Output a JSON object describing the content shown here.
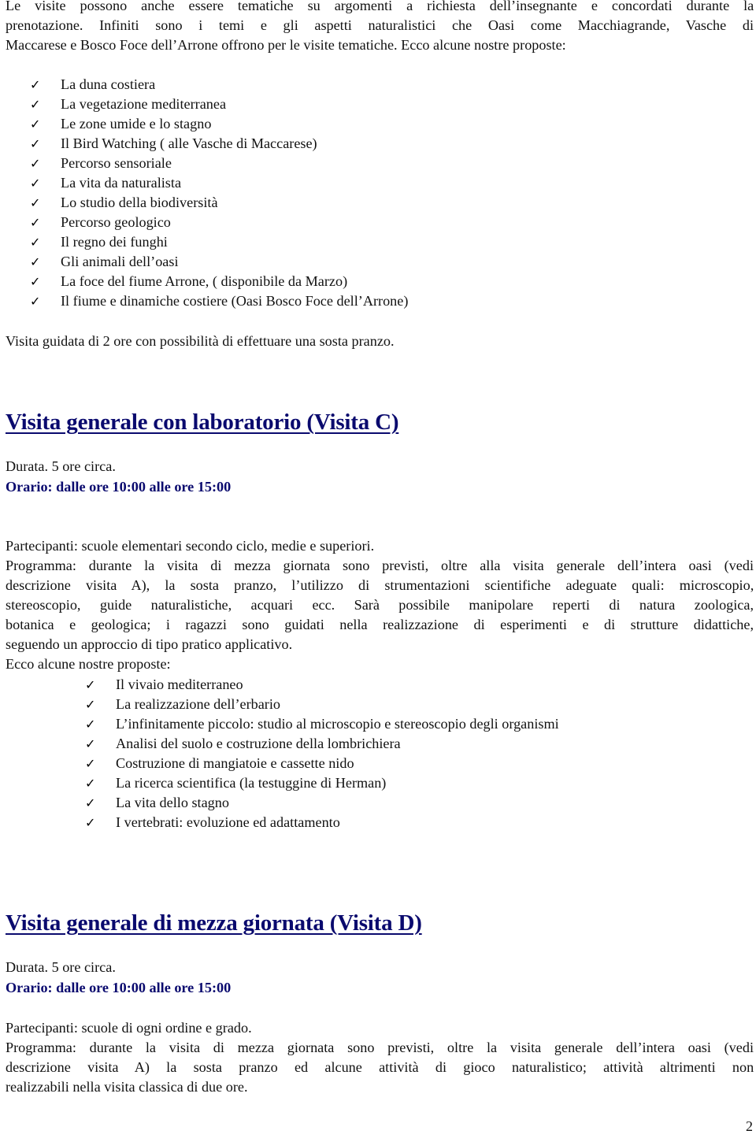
{
  "intro": {
    "lines": [
      "Le visite possono anche essere tematiche su argomenti a richiesta dell’insegnante e concordati durante la",
      "prenotazione. Infiniti sono i temi e gli aspetti naturalistici che Oasi come Macchiagrande, Vasche di",
      "Maccarese e Bosco Foce dell’Arrone offrono per le visite tematiche. Ecco alcune nostre proposte:"
    ]
  },
  "thematic_list": {
    "icon": "checkmark-icon",
    "glyph": "✓",
    "items": [
      "La duna costiera",
      "La vegetazione mediterranea",
      "Le zone umide e lo stagno",
      "Il Bird Watching ( alle Vasche di Maccarese)",
      "Percorso sensoriale",
      "La vita da naturalista",
      "Lo studio della biodiversità",
      "Percorso geologico",
      "Il regno dei funghi",
      "Gli animali dell’oasi",
      "La foce del fiume Arrone, ( disponibile da Marzo)",
      "Il fiume e dinamiche costiere (Oasi Bosco Foce dell’Arrone)"
    ]
  },
  "guided_note": "Visita guidata di 2 ore con possibilità di effettuare una sosta pranzo.",
  "visit_c": {
    "heading": "Visita generale con laboratorio (Visita  C)",
    "durata": "Durata. 5 ore circa.",
    "orario": "Orario: dalle ore 10:00 alle ore 15:00",
    "partecipanti": "Partecipanti: scuole elementari secondo ciclo, medie e superiori.",
    "programma_lines": [
      "Programma: durante la visita di mezza giornata sono previsti, oltre alla visita generale dell’intera oasi (vedi",
      "descrizione visita A), la sosta pranzo, l’utilizzo di strumentazioni scientifiche adeguate quali: microscopio,",
      "stereoscopio, guide naturalistiche, acquari ecc. Sarà possibile manipolare reperti di natura zoologica,",
      "botanica e geologica; i ragazzi sono guidati nella realizzazione di esperimenti e di strutture didattiche,",
      "seguendo un approccio di tipo pratico applicativo."
    ],
    "proposte_intro": "Ecco alcune nostre proposte:",
    "proposte": [
      "Il vivaio mediterraneo",
      "La realizzazione dell’erbario",
      "L’infinitamente piccolo: studio al microscopio e stereoscopio degli organismi",
      "Analisi del suolo e costruzione della lombrichiera",
      "Costruzione di mangiatoie e cassette nido",
      "La ricerca scientifica (la testuggine di Herman)",
      "La vita dello stagno",
      "I vertebrati: evoluzione ed adattamento"
    ]
  },
  "visit_d": {
    "heading": "Visita generale di mezza giornata (Visita  D)",
    "durata": "Durata. 5 ore circa.",
    "orario": "Orario: dalle ore 10:00 alle ore 15:00",
    "partecipanti": "Partecipanti: scuole di ogni ordine e grado.",
    "programma_lines": [
      "Programma: durante la visita di mezza giornata sono previsti, oltre la visita generale dell’intera oasi (vedi",
      "descrizione visita A) la sosta pranzo ed alcune attività di gioco naturalistico; attività altrimenti non",
      "realizzabili nella visita classica di due ore."
    ]
  },
  "colors": {
    "heading": "#0a0a6e",
    "text": "#111111"
  },
  "page_number": "2"
}
